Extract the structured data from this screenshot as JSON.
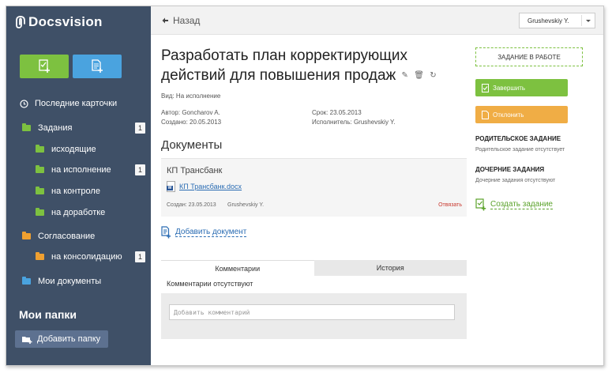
{
  "app": {
    "logo_text": "Docsvision"
  },
  "sidebar": {
    "recent_label": "Последние карточки",
    "tasks_label": "Задания",
    "tasks_badge": "1",
    "outgoing_label": "исходящие",
    "in_progress_label": "на исполнение",
    "in_progress_badge": "1",
    "control_label": "на контроле",
    "rework_label": "на доработке",
    "approval_label": "Согласование",
    "consolidation_label": "на консолидацию",
    "consolidation_badge": "1",
    "my_docs_label": "Мои документы",
    "my_folders_title": "Мои папки",
    "add_folder_label": "Добавить папку"
  },
  "topbar": {
    "back_label": "Назад",
    "user_name": "Grushevskiy Y."
  },
  "task": {
    "title": "Разработать план корректирующих действий для повышения продаж",
    "type_text": "Вид: На исполнение",
    "author_text": "Автор: Goncharov A.",
    "created_text": "Создано: 20.05.2013",
    "deadline_text": "Срок: 23.05.2013",
    "executor_text": "Исполнитель: Grushevskiy Y."
  },
  "documents": {
    "heading": "Документы",
    "card_name": "КП Трансбанк",
    "file_name": "КП Трансбанк.docx",
    "file_type_letter": "W",
    "created_text": "Создан: 23.05.2013",
    "creator": "Grushevskiy Y.",
    "unlink_label": "Отвязать",
    "add_label": "Добавить документ"
  },
  "comments": {
    "tab_comments": "Комментарии",
    "tab_history": "История",
    "empty_text": "Комментарии отсутствуют",
    "input_placeholder": "Добавить комментарий"
  },
  "actions": {
    "status_text": "ЗАДАНИЕ В РАБОТЕ",
    "complete_label": "Завершить",
    "reject_label": "Отклонить",
    "parent_heading": "РОДИТЕЛЬСКОЕ ЗАДАНИЕ",
    "parent_empty": "Родительское задание отсутствует",
    "child_heading": "ДОЧЕРНИЕ ЗАДАНИЯ",
    "child_empty": "Дочерние задания отсутствуют",
    "create_task_label": "Создать задание"
  },
  "colors": {
    "sidebar_bg": "#3f5067",
    "accent_green": "#7dc140",
    "accent_blue": "#4aa3df",
    "accent_orange": "#f0ad45",
    "link_blue": "#2a6cb3",
    "unlink_red": "#c8372d"
  }
}
